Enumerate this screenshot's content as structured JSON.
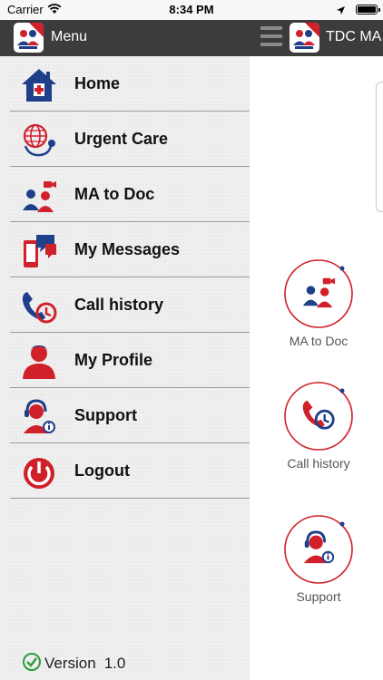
{
  "status_bar": {
    "carrier": "Carrier",
    "time": "8:34 PM"
  },
  "drawer": {
    "title": "Menu",
    "items": [
      {
        "label": "Home",
        "icon": "home-icon"
      },
      {
        "label": "Urgent Care",
        "icon": "globe-stethoscope-icon"
      },
      {
        "label": "MA to Doc",
        "icon": "doctors-video-icon"
      },
      {
        "label": "My Messages",
        "icon": "phone-chat-icon"
      },
      {
        "label": "Call history",
        "icon": "call-history-icon"
      },
      {
        "label": "My Profile",
        "icon": "profile-icon"
      },
      {
        "label": "Support",
        "icon": "support-agent-icon"
      },
      {
        "label": "Logout",
        "icon": "power-icon"
      }
    ],
    "version_label": "Version",
    "version_number": "1.0"
  },
  "main": {
    "title": "TDC MA T",
    "quick_actions": [
      {
        "label": "MA to Doc",
        "icon": "doctors-video-icon"
      },
      {
        "label": "Call history",
        "icon": "call-history-icon"
      },
      {
        "label": "Support",
        "icon": "support-agent-icon"
      }
    ]
  },
  "colors": {
    "brand_red": "#d0202a",
    "brand_blue": "#1f3f8a",
    "header_dark": "#3c3c3c",
    "drawer_bg": "#efefef",
    "version_check_green": "#2e9b3a"
  }
}
